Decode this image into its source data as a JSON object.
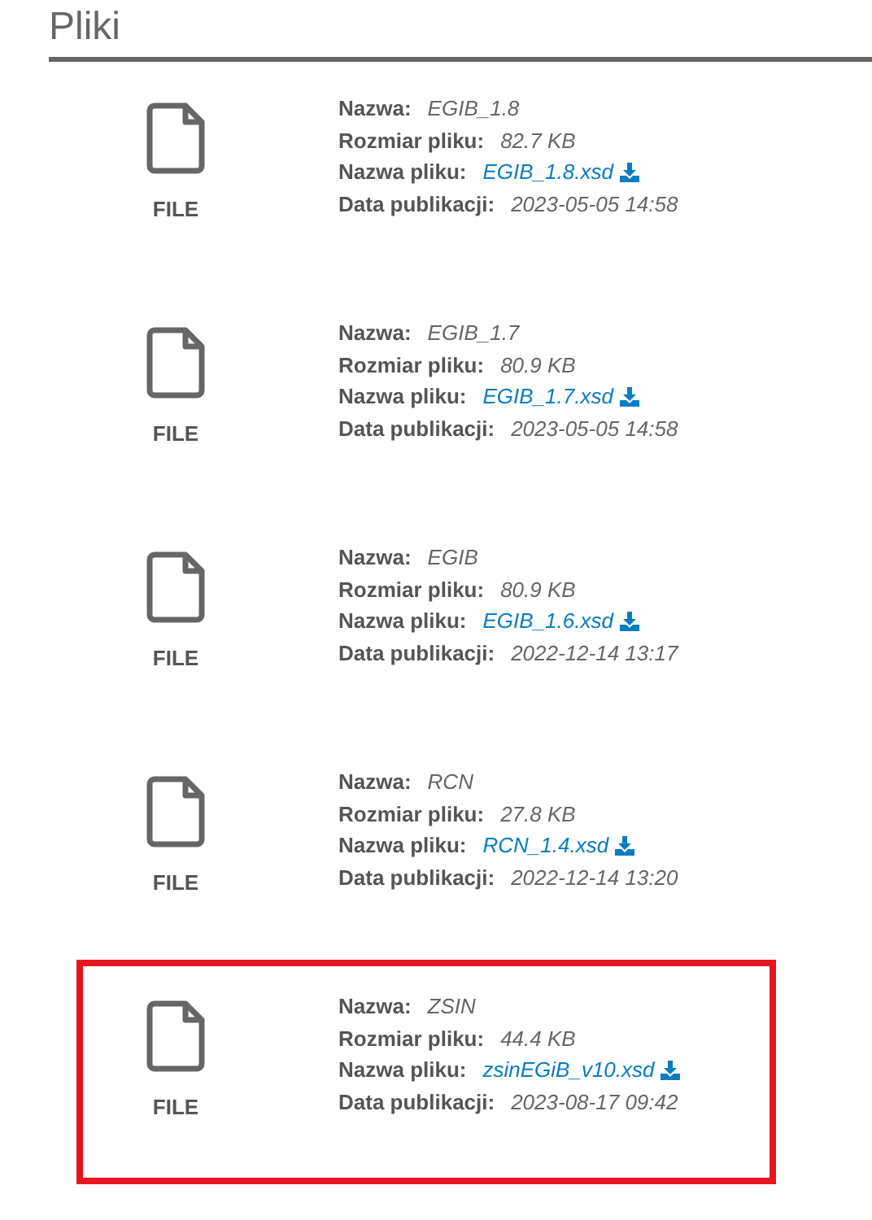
{
  "title": "Pliki",
  "files": [
    {
      "type_label": "FILE",
      "name_label": "Nazwa:",
      "name": "EGIB_1.8",
      "size_label": "Rozmiar pliku:",
      "size": "82.7 KB",
      "filename_label": "Nazwa pliku:",
      "filename": "EGIB_1.8.xsd",
      "date_label": "Data publikacji:",
      "date": "2023-05-05 14:58",
      "highlighted": false
    },
    {
      "type_label": "FILE",
      "name_label": "Nazwa:",
      "name": "EGIB_1.7",
      "size_label": "Rozmiar pliku:",
      "size": "80.9 KB",
      "filename_label": "Nazwa pliku:",
      "filename": "EGIB_1.7.xsd",
      "date_label": "Data publikacji:",
      "date": "2023-05-05 14:58",
      "highlighted": false
    },
    {
      "type_label": "FILE",
      "name_label": "Nazwa:",
      "name": "EGIB",
      "size_label": "Rozmiar pliku:",
      "size": "80.9 KB",
      "filename_label": "Nazwa pliku:",
      "filename": "EGIB_1.6.xsd",
      "date_label": "Data publikacji:",
      "date": "2022-12-14 13:17",
      "highlighted": false
    },
    {
      "type_label": "FILE",
      "name_label": "Nazwa:",
      "name": "RCN",
      "size_label": "Rozmiar pliku:",
      "size": "27.8 KB",
      "filename_label": "Nazwa pliku:",
      "filename": "RCN_1.4.xsd",
      "date_label": "Data publikacji:",
      "date": "2022-12-14 13:20",
      "highlighted": false
    },
    {
      "type_label": "FILE",
      "name_label": "Nazwa:",
      "name": "ZSIN",
      "size_label": "Rozmiar pliku:",
      "size": "44.4 KB",
      "filename_label": "Nazwa pliku:",
      "filename": "zsinEGiB_v10.xsd",
      "date_label": "Data publikacji:",
      "date": "2023-08-17 09:42",
      "highlighted": true
    }
  ]
}
